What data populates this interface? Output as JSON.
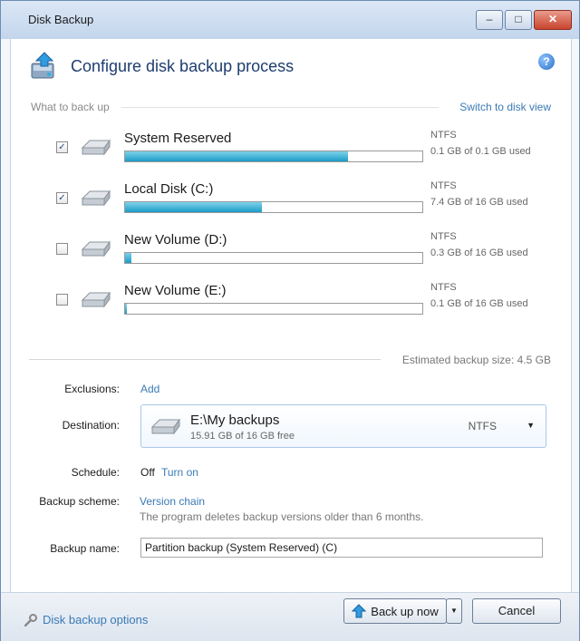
{
  "window": {
    "title": "Disk Backup",
    "minimize": "–",
    "maximize": "□",
    "close": "✕"
  },
  "header": {
    "title": "Configure disk backup process",
    "help": "?"
  },
  "what_to_back_up": {
    "label": "What to back up",
    "switch_link": "Switch to disk view",
    "disks": [
      {
        "name": "System Reserved",
        "fs": "NTFS",
        "usage": "0.1 GB of 0.1 GB used",
        "checked": true,
        "used_fraction": 0.75
      },
      {
        "name": "Local Disk (C:)",
        "fs": "NTFS",
        "usage": "7.4 GB of 16 GB used",
        "checked": true,
        "used_fraction": 0.46
      },
      {
        "name": "New Volume (D:)",
        "fs": "NTFS",
        "usage": "0.3 GB of 16 GB used",
        "checked": false,
        "used_fraction": 0.02
      },
      {
        "name": "New Volume (E:)",
        "fs": "NTFS",
        "usage": "0.1 GB of 16 GB used",
        "checked": false,
        "used_fraction": 0.0
      }
    ],
    "estimated": "Estimated backup size: 4.5 GB"
  },
  "exclusions": {
    "label": "Exclusions:",
    "add": "Add"
  },
  "destination": {
    "label": "Destination:",
    "path": "E:\\My backups",
    "free": "15.91 GB of 16 GB free",
    "fs": "NTFS",
    "arrow": "▼"
  },
  "schedule": {
    "label": "Schedule:",
    "status": "Off",
    "link": "Turn on"
  },
  "scheme": {
    "label": "Backup scheme:",
    "link": "Version chain",
    "note": "The program deletes backup versions older than 6 months."
  },
  "backup_name": {
    "label": "Backup name:",
    "value": "Partition backup (System Reserved) (C)"
  },
  "footer": {
    "options": "Disk backup options",
    "backup_now": "Back up now",
    "split": "▼",
    "cancel": "Cancel"
  }
}
